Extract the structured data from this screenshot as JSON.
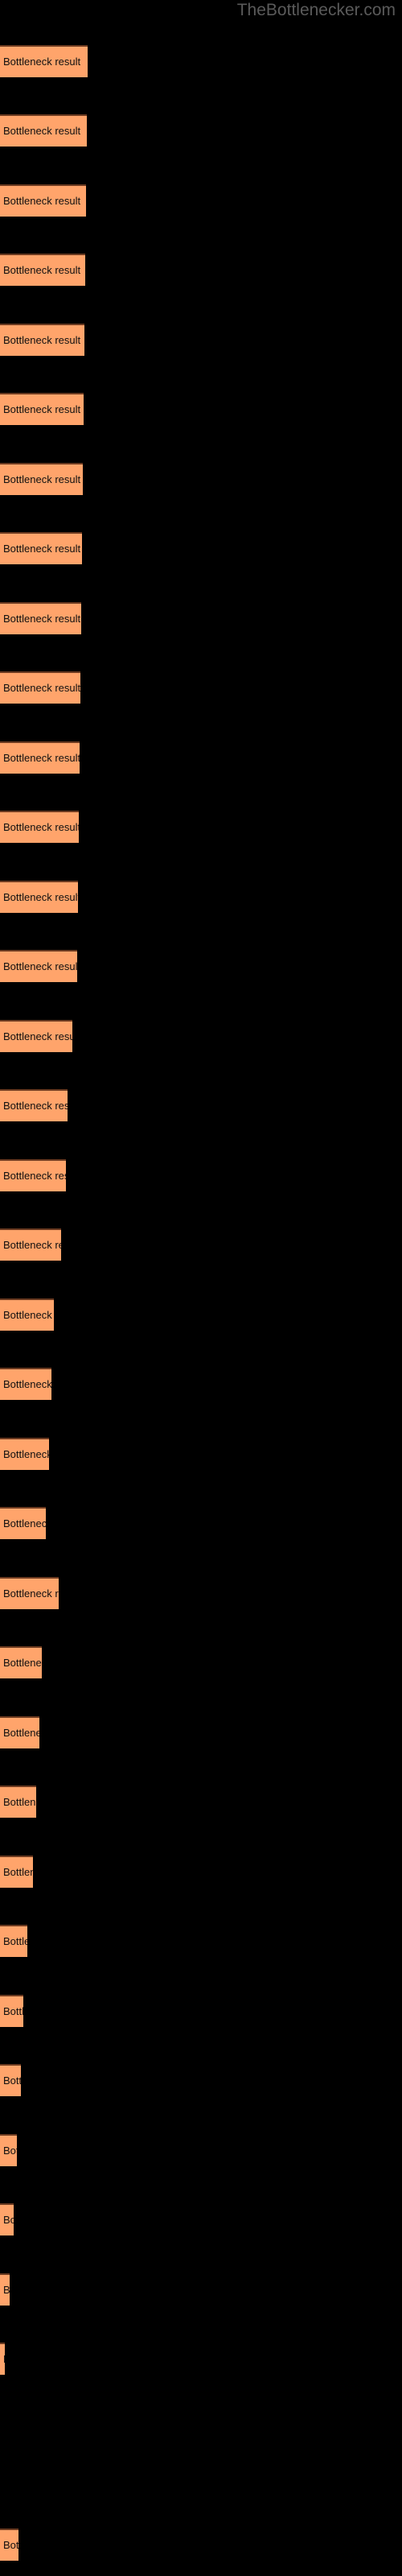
{
  "watermark": {
    "text": "TheBottlenecker.com"
  },
  "colors": {
    "background": "#000000",
    "bar_fill": "#FFA46B",
    "bar_border_top": "#6b3a20",
    "label_text": "#101010",
    "watermark_text": "#5a5a5a"
  },
  "chart_data": {
    "type": "bar",
    "orientation": "horizontal",
    "title": "TheBottlenecker.com",
    "xlabel": "",
    "ylabel": "",
    "grid": false,
    "legend": false,
    "bar_label_text": "Bottleneck result",
    "xlim": [
      0,
      500
    ],
    "categories": [
      "Bottleneck result",
      "Bottleneck result",
      "Bottleneck result",
      "Bottleneck result",
      "Bottleneck result",
      "Bottleneck result",
      "Bottleneck result",
      "Bottleneck result",
      "Bottleneck result",
      "Bottleneck result",
      "Bottleneck result",
      "Bottleneck result",
      "Bottleneck result",
      "Bottleneck result",
      "Bottleneck result",
      "Bottleneck result",
      "Bottleneck result",
      "Bottleneck result",
      "Bottleneck result",
      "Bottleneck result",
      "Bottleneck result",
      "Bottleneck result",
      "Bottleneck result",
      "Bottleneck result",
      "Bottleneck result",
      "Bottleneck result",
      "Bottleneck result",
      "Bottleneck result",
      "Bottleneck result",
      "Bottleneck result",
      "Bottleneck result",
      "Bottleneck result",
      "Bottleneck result",
      "Bottleneck result",
      "Bottleneck result"
    ],
    "values": [
      109,
      108,
      107,
      106,
      105,
      104,
      103,
      102,
      101,
      100,
      99,
      98,
      97,
      96,
      90,
      84,
      82,
      76,
      67,
      64,
      61,
      57,
      73,
      52,
      49,
      45,
      41,
      34,
      29,
      26,
      21,
      17,
      12,
      6,
      23
    ],
    "bar_tops": [
      56,
      142,
      229,
      315,
      402,
      488,
      575,
      661,
      748,
      834,
      921,
      1007,
      1094,
      1180,
      1267,
      1353,
      1440,
      1526,
      1613,
      1699,
      1786,
      1872,
      1959,
      2045,
      2132,
      2218,
      2305,
      2391,
      2478,
      2564,
      2651,
      2737,
      2824,
      2910,
      3141
    ]
  }
}
